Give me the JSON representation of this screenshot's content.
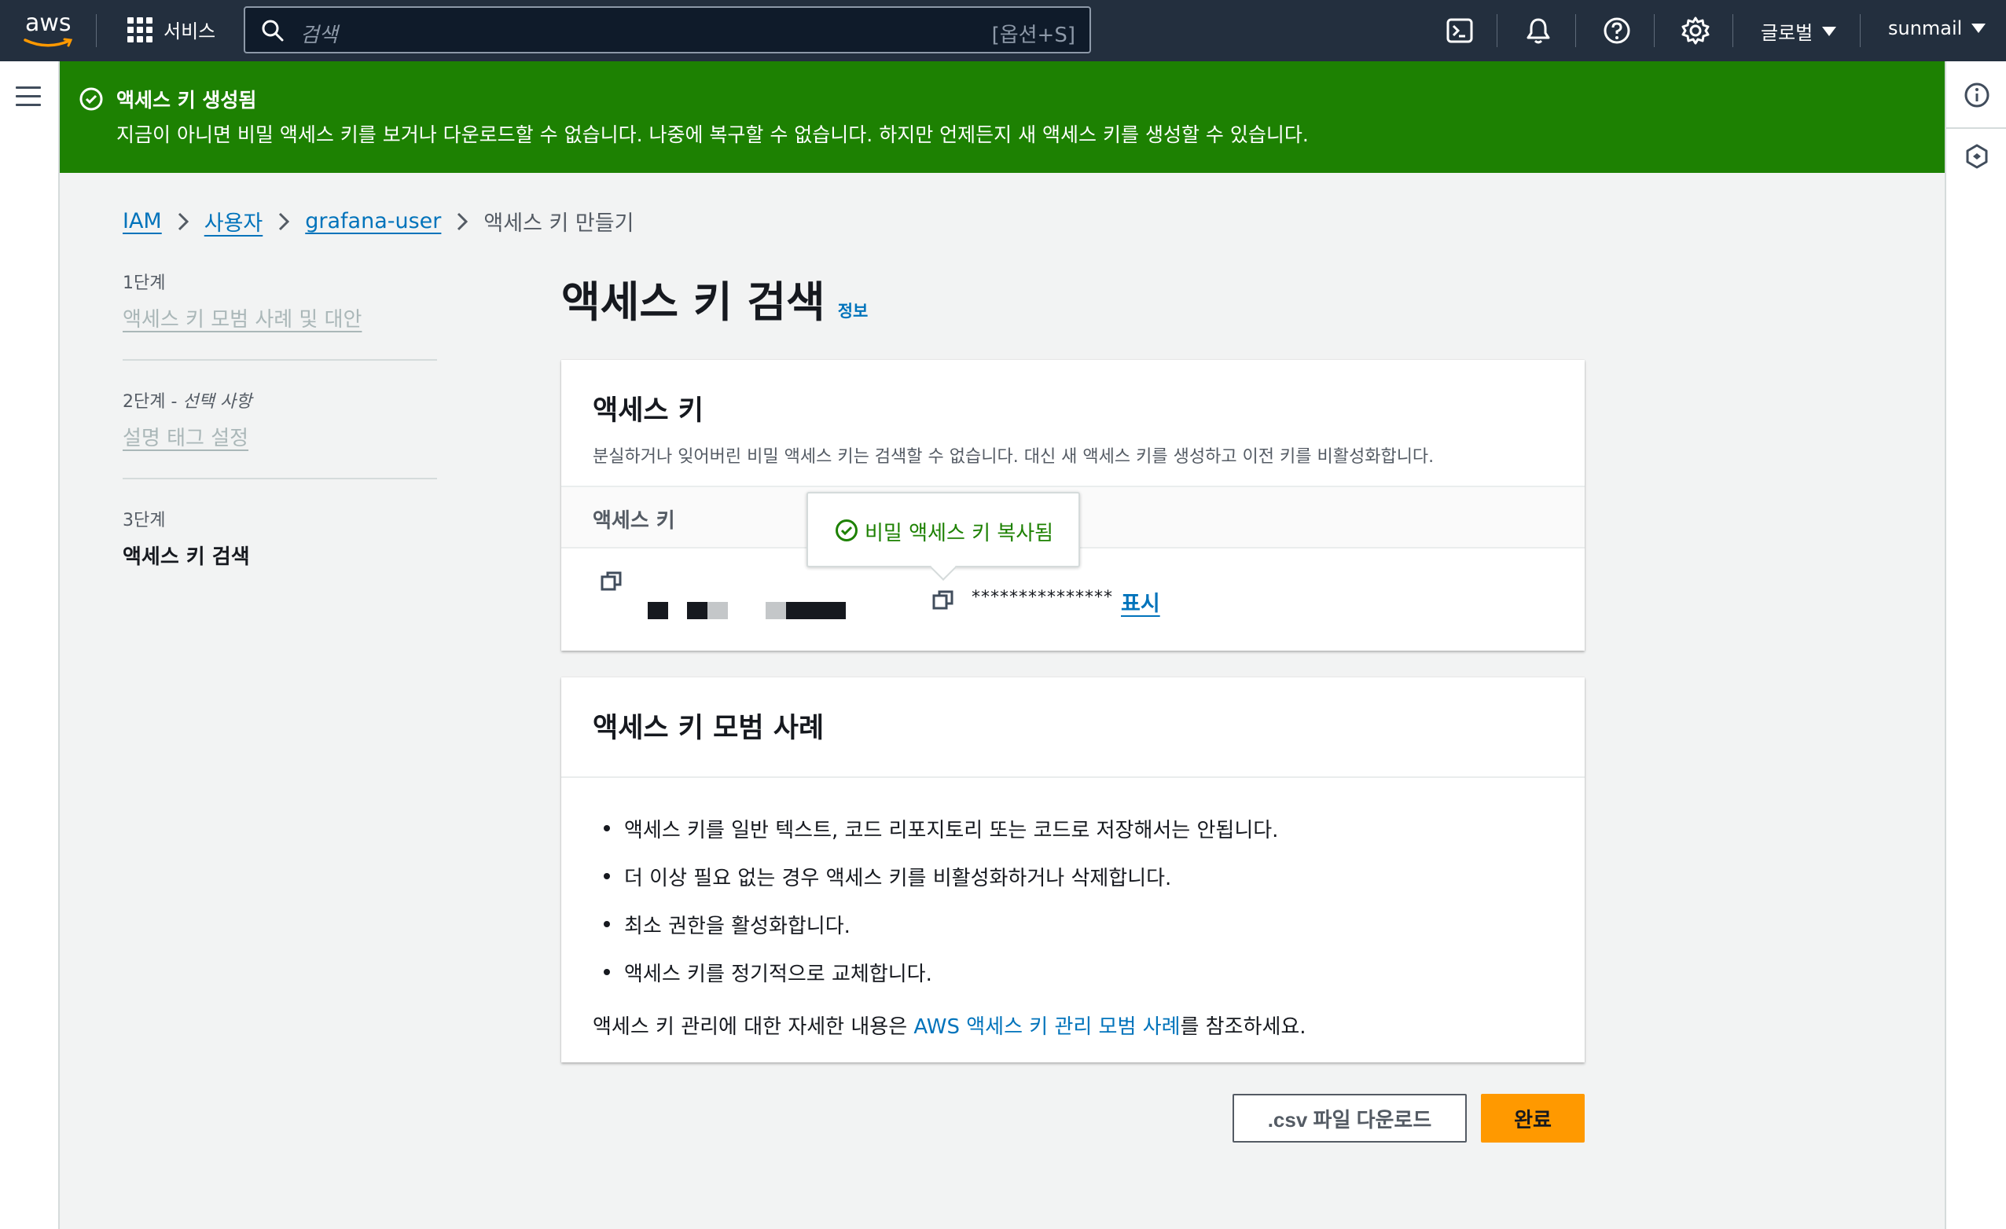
{
  "topnav": {
    "logo_text": "aws",
    "services_label": "서비스",
    "search_placeholder": "검색",
    "search_shortcut": "[옵션+S]",
    "region": "글로벌",
    "account": "sunmail"
  },
  "flash": {
    "title": "액세스 키 생성됨",
    "message": "지금이 아니면 비밀 액세스 키를 보거나 다운로드할 수 없습니다. 나중에 복구할 수 없습니다. 하지만 언제든지 새 액세스 키를 생성할 수 있습니다."
  },
  "breadcrumb": {
    "items": [
      "IAM",
      "사용자",
      "grafana-user"
    ],
    "current": "액세스 키 만들기"
  },
  "steps": [
    {
      "num": "1단계",
      "name": "액세스 키 모범 사례 및 대안"
    },
    {
      "num": "2단계 - ",
      "num_optional": "선택 사항",
      "name": "설명 태그 설정"
    },
    {
      "num": "3단계",
      "name": "액세스 키 검색"
    }
  ],
  "page": {
    "title": "액세스 키 검색",
    "info": "정보"
  },
  "access_key_panel": {
    "title": "액세스 키",
    "description": "분실하거나 잊어버린 비밀 액세스 키는 검색할 수 없습니다. 대신 새 액세스 키를 생성하고 이전 키를 비활성화합니다.",
    "column_header": "액세스 키",
    "secret_masked": "***************",
    "show_label": "표시",
    "popover_text": "비밀 액세스 키 복사됨"
  },
  "best_practices": {
    "title": "액세스 키 모범 사례",
    "items": [
      "액세스 키를 일반 텍스트, 코드 리포지토리 또는 코드로 저장해서는 안됩니다.",
      "더 이상 필요 없는 경우 액세스 키를 비활성화하거나 삭제합니다.",
      "최소 권한을 활성화합니다.",
      "액세스 키를 정기적으로 교체합니다."
    ],
    "footer_prefix": "액세스 키 관리에 대한 자세한 내용은 ",
    "footer_link": "AWS 액세스 키 관리 모범 사례",
    "footer_suffix": "를 참조하세요."
  },
  "actions": {
    "download_csv": ".csv 파일 다운로드",
    "done": "완료"
  },
  "colors": {
    "nav_bg": "#232f3e",
    "success": "#1d8102",
    "link": "#0073bb",
    "primary": "#ff9900"
  },
  "icons": [
    "menu-icon",
    "grid-icon",
    "search-icon",
    "cloudshell-icon",
    "bell-icon",
    "help-icon",
    "gear-icon",
    "info-icon",
    "feedback-icon",
    "check-circle-icon",
    "copy-icon"
  ]
}
